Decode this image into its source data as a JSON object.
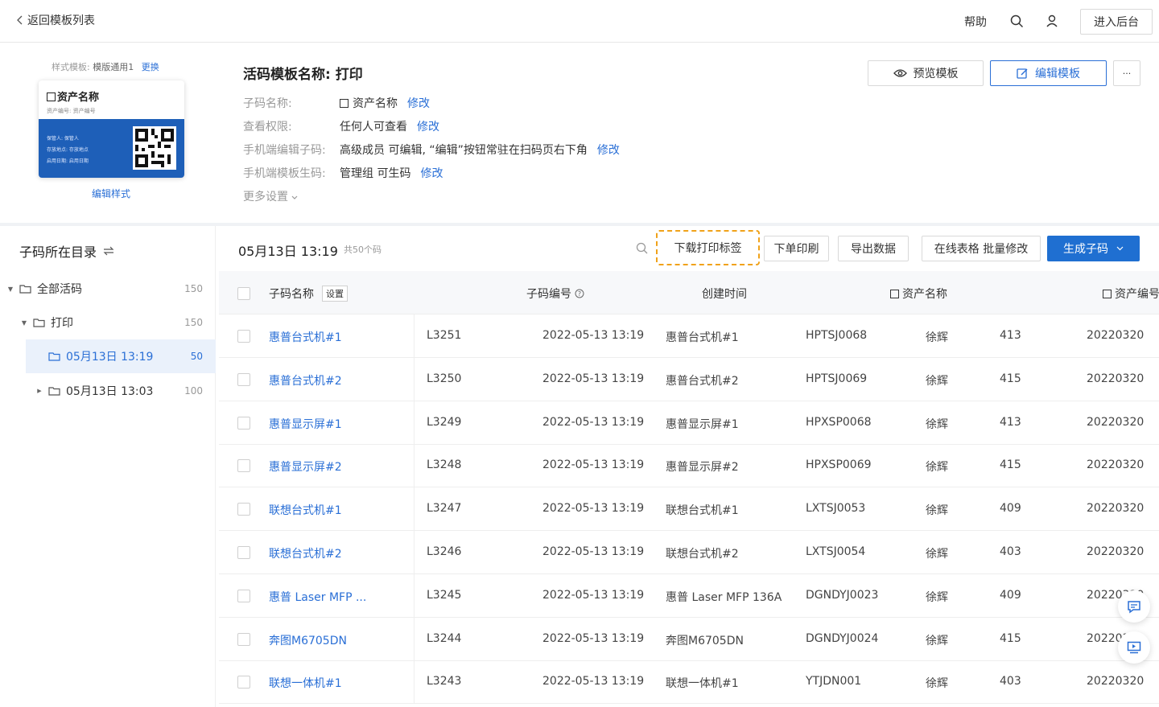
{
  "topbar": {
    "back_label": "返回模板列表",
    "help_label": "帮助",
    "admin_label": "进入后台"
  },
  "template": {
    "style_caption": "样式模板:",
    "style_value": "模版通用1",
    "style_change": "更换",
    "card_title": "资产名称",
    "card_sub": "资产编号: 资产编号",
    "card_lines": [
      "保管人: 保管人",
      "存放地点: 存放地点",
      "启用日期: 启用日期"
    ],
    "edit_style": "编辑样式",
    "name": "活码模板名称: 打印",
    "info": [
      {
        "key": "子码名称:",
        "value": "资产名称",
        "link": "修改"
      },
      {
        "key": "查看权限:",
        "value": "任何人可查看",
        "link": "修改"
      },
      {
        "key": "手机端编辑子码:",
        "value": "高级成员 可编辑, “编辑”按钮常驻在扫码页右下角",
        "link": "修改"
      },
      {
        "key": "手机端模板生码:",
        "value": "管理组 可生码",
        "link": "修改"
      }
    ],
    "more_settings": "更多设置",
    "preview_label": "预览模板",
    "edit_label": "编辑模板",
    "more_label": "···"
  },
  "sidebar": {
    "title": "子码所在目录",
    "tree": [
      {
        "label": "全部活码",
        "count": "150"
      },
      {
        "label": "打印",
        "count": "150"
      },
      {
        "label": "05月13日 13:19",
        "count": "50"
      },
      {
        "label": "05月13日 13:03",
        "count": "100"
      }
    ]
  },
  "toolbar": {
    "batch_title": "05月13日 13:19",
    "batch_count": "共50个码",
    "download_label": "下载打印标签",
    "print_order_label": "下单印刷",
    "export_label": "导出数据",
    "online_edit_label": "在线表格 批量修改",
    "generate_label": "生成子码"
  },
  "table": {
    "headers": {
      "name": "子码名称",
      "settings": "设置",
      "code": "子码编号",
      "created": "创建时间",
      "asset_name": "资产名称",
      "asset_no": "资产编号"
    },
    "rows": [
      {
        "name": "惠普台式机#1",
        "code": "L3251",
        "created": "2022-05-13 13:19",
        "asset": "惠普台式机#1",
        "asset_no": "HPTSJ0068",
        "keeper": "徐辉",
        "room": "413",
        "date": "20220320"
      },
      {
        "name": "惠普台式机#2",
        "code": "L3250",
        "created": "2022-05-13 13:19",
        "asset": "惠普台式机#2",
        "asset_no": "HPTSJ0069",
        "keeper": "徐辉",
        "room": "415",
        "date": "20220320"
      },
      {
        "name": "惠普显示屏#1",
        "code": "L3249",
        "created": "2022-05-13 13:19",
        "asset": "惠普显示屏#1",
        "asset_no": "HPXSP0068",
        "keeper": "徐辉",
        "room": "413",
        "date": "20220320"
      },
      {
        "name": "惠普显示屏#2",
        "code": "L3248",
        "created": "2022-05-13 13:19",
        "asset": "惠普显示屏#2",
        "asset_no": "HPXSP0069",
        "keeper": "徐辉",
        "room": "415",
        "date": "20220320"
      },
      {
        "name": "联想台式机#1",
        "code": "L3247",
        "created": "2022-05-13 13:19",
        "asset": "联想台式机#1",
        "asset_no": "LXTSJ0053",
        "keeper": "徐辉",
        "room": "409",
        "date": "20220320"
      },
      {
        "name": "联想台式机#2",
        "code": "L3246",
        "created": "2022-05-13 13:19",
        "asset": "联想台式机#2",
        "asset_no": "LXTSJ0054",
        "keeper": "徐辉",
        "room": "403",
        "date": "20220320"
      },
      {
        "name": "惠普 Laser MFP ...",
        "code": "L3245",
        "created": "2022-05-13 13:19",
        "asset": "惠普 Laser MFP 136A",
        "asset_no": "DGNDYJ0023",
        "keeper": "徐辉",
        "room": "409",
        "date": "20220320"
      },
      {
        "name": "奔图M6705DN",
        "code": "L3244",
        "created": "2022-05-13 13:19",
        "asset": "奔图M6705DN",
        "asset_no": "DGNDYJ0024",
        "keeper": "徐辉",
        "room": "415",
        "date": "20220320"
      },
      {
        "name": "联想一体机#1",
        "code": "L3243",
        "created": "2022-05-13 13:19",
        "asset": "联想一体机#1",
        "asset_no": "YTJDN001",
        "keeper": "徐辉",
        "room": "403",
        "date": "20220320"
      }
    ]
  },
  "colors": {
    "accent": "#2a6fd6",
    "primary_button": "#1f6fd1",
    "highlight": "#f0a21a"
  }
}
